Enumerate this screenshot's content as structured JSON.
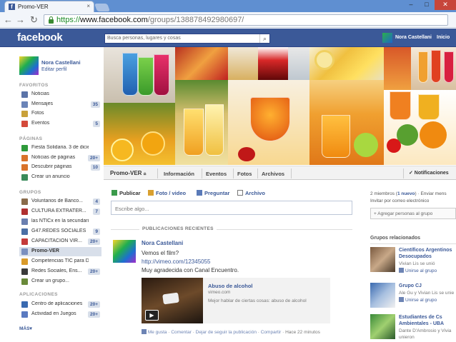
{
  "browser": {
    "tab_title": "Promo-VER",
    "tab_close": "×",
    "url_scheme": "https://",
    "url_domain": "www.facebook.com",
    "url_path": "/groups/138878492980697/",
    "window_buttons": [
      "–",
      "□",
      "✕"
    ]
  },
  "header": {
    "logo": "facebook",
    "search_placeholder": "Busca personas, lugares y cosas",
    "user_name": "Nora Castellani",
    "home_label": "Inicio"
  },
  "sidebar": {
    "user_name": "Nora Castellani",
    "edit_profile": "Editar perfil",
    "favorites_header": "FAVORITOS",
    "favorites": [
      {
        "label": "Noticias",
        "count": "",
        "icon": "news-feed-icon",
        "color": "#5b74a8"
      },
      {
        "label": "Mensajes",
        "count": "35",
        "icon": "messages-icon",
        "color": "#6b84b8"
      },
      {
        "label": "Fotos",
        "count": "",
        "icon": "photos-icon",
        "color": "#c9a13a"
      },
      {
        "label": "Eventos",
        "count": "5",
        "icon": "events-icon",
        "color": "#d44a3a"
      }
    ],
    "pages_header": "PÁGINAS",
    "pages": [
      {
        "label": "Fiesta Solidaria. 3 de diciem...",
        "count": "",
        "icon": "page-icon",
        "color": "#2e9a3a"
      },
      {
        "label": "Noticias de páginas",
        "count": "20+",
        "icon": "page-feed-icon",
        "color": "#d9732a"
      },
      {
        "label": "Descubrir páginas",
        "count": "10",
        "icon": "discover-pages-icon",
        "color": "#d9732a"
      },
      {
        "label": "Crear un anuncio",
        "count": "",
        "icon": "create-ad-icon",
        "color": "#3a8b5a"
      }
    ],
    "groups_header": "GRUPOS",
    "groups": [
      {
        "label": "Voluntarios de Banco...",
        "count": "4",
        "icon": "group-icon",
        "color": "#8a6b4a"
      },
      {
        "label": "CULTURA EXTRATER...",
        "count": "7",
        "icon": "group-icon",
        "color": "#b03030"
      },
      {
        "label": "las NTICx en la secundaria",
        "count": "",
        "icon": "group-icon",
        "color": "#6a7fb0"
      },
      {
        "label": "G47.REDES SOCIALES",
        "count": "9",
        "icon": "group-icon",
        "color": "#4a6fa5"
      },
      {
        "label": "CAPACITACION VIR...",
        "count": "20+",
        "icon": "group-icon",
        "color": "#c43a3a"
      },
      {
        "label": "Promo-VER",
        "count": "",
        "icon": "group-icon",
        "color": "#7a8fbf",
        "selected": true
      },
      {
        "label": "Competencias TIC para Doc...",
        "count": "",
        "icon": "group-icon",
        "color": "#d99a2a"
      },
      {
        "label": "Redes Sociales, Ens...",
        "count": "20+",
        "icon": "group-icon",
        "color": "#3a3a3a"
      },
      {
        "label": "Crear un grupo...",
        "count": "",
        "icon": "create-group-icon",
        "color": "#6a8a3a"
      }
    ],
    "apps_header": "APLICACIONES",
    "apps": [
      {
        "label": "Centro de aplicaciones",
        "count": "20+",
        "icon": "app-center-icon",
        "color": "#3a6ab0"
      },
      {
        "label": "Actividad en Juegos",
        "count": "20+",
        "icon": "games-icon",
        "color": "#5a7ac0"
      }
    ],
    "more": "MÁS▾"
  },
  "group": {
    "name": "Promo-VER",
    "tabs": [
      "Información",
      "Eventos",
      "Fotos",
      "Archivos"
    ],
    "notifications": "✓ Notificaciones"
  },
  "composer": {
    "publish": "Publicar",
    "photo": "Foto / video",
    "ask": "Preguntar",
    "file": "Archivo",
    "placeholder": "Escribe algo..."
  },
  "feed": {
    "header": "PUBLICACIONES RECIENTES",
    "post": {
      "author": "Nora Castellani",
      "text1": "Vemos el film?",
      "link": "http://vimeo.com/12345055",
      "text2": "Muy agradecida con Canal Encuentro.",
      "attachment_title": "Abuso de alcohol",
      "attachment_domain": "vimeo.com",
      "attachment_desc": "Mejor hablar de ciertas cosas: abuso de alcohol",
      "actions": {
        "like": "Me gusta",
        "comment": "Comentar",
        "unfollow": "Dejar de seguir la publicación",
        "share": "Compartir",
        "time": "Hace 22 minutos",
        "sep": " · "
      }
    }
  },
  "right": {
    "members_prefix": "2 miembros (",
    "members_new": "1 nuevo",
    "members_suffix": ") · Enviar mens",
    "invite": "Invitar por correo electrónico",
    "add_people": "+ Agregar personas al grupo",
    "related_header": "Grupos relacionados",
    "related": [
      {
        "name1": "Científicos Argentinos",
        "name2": "Desocupados",
        "sub": "Vivian Lis se unió",
        "join": "Unirse al grupo"
      },
      {
        "name1": "Grupo CJ",
        "name2": "",
        "sub": "Ale Gu y Vivian Lis se unie",
        "join": "Unirse al grupo"
      },
      {
        "name1": "Estudiantes de Cs",
        "name2": "Ambientales - UBA",
        "sub": "Dante D'Ambrosio y Vivia",
        "sub2": "unieron",
        "join": ""
      }
    ]
  },
  "colors": {
    "fb_blue": "#3b5998",
    "link": "#3b5998",
    "badge_bg": "#d8dfea"
  }
}
